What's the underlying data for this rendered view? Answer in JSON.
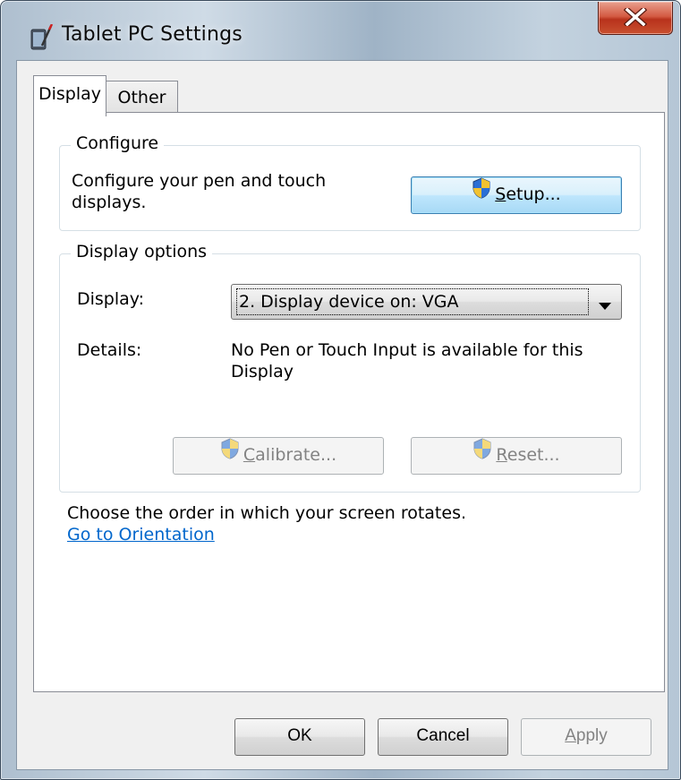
{
  "window": {
    "title": "Tablet PC Settings",
    "close_label": "X"
  },
  "tabs": [
    {
      "label": "Display",
      "selected": true
    },
    {
      "label": "Other",
      "selected": false
    }
  ],
  "configure": {
    "group_label": "Configure",
    "description": "Configure your pen and touch displays.",
    "setup_button": {
      "label_prefix": "",
      "mnemonic": "S",
      "label_rest": "etup..."
    }
  },
  "display_options": {
    "group_label": "Display options",
    "display_label": "Display:",
    "display_value": "2. Display device on: VGA",
    "details_label": "Details:",
    "details_value": "No Pen or Touch Input is available for this Display",
    "calibrate_button": {
      "mnemonic": "C",
      "label_rest": "alibrate...",
      "enabled": false
    },
    "reset_button": {
      "mnemonic": "R",
      "label_rest": "eset...",
      "enabled": false
    }
  },
  "orientation": {
    "text": "Choose the order in which your screen rotates.",
    "link": "Go to Orientation"
  },
  "footer": {
    "ok": "OK",
    "cancel": "Cancel",
    "apply_mnemonic": "A",
    "apply_rest": "pply",
    "apply_enabled": false
  },
  "colors": {
    "link": "#0066cc",
    "close_button": "#c9502f",
    "focus_button": "#bee6fd"
  },
  "icons": {
    "title": "tablet-pc-icon",
    "shield": "uac-shield-icon",
    "dropdown": "chevron-down-icon",
    "close": "close-icon"
  }
}
